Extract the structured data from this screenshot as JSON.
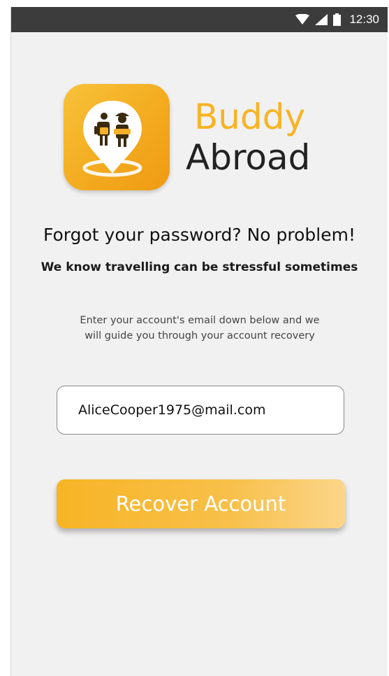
{
  "status_bar": {
    "time": "12:30",
    "icons": [
      "wifi-icon",
      "signal-icon",
      "battery-icon"
    ]
  },
  "brand": {
    "line1": "Buddy",
    "line2": "Abroad",
    "accent_color": "#f7b424",
    "dark_color": "#222222"
  },
  "heading": "Forgot your password? No problem!",
  "subheading": "We know travelling can be stressful sometimes",
  "instructions": {
    "line1": "Enter your account's email down below and we",
    "line2": "will guide you through your account recovery"
  },
  "email_field": {
    "value": "AliceCooper1975@mail.com"
  },
  "recover_button": {
    "label": "Recover Account"
  },
  "colors": {
    "status_bar": "#3c3c3c",
    "background": "#f1f1f1",
    "button": "#f7b425"
  }
}
